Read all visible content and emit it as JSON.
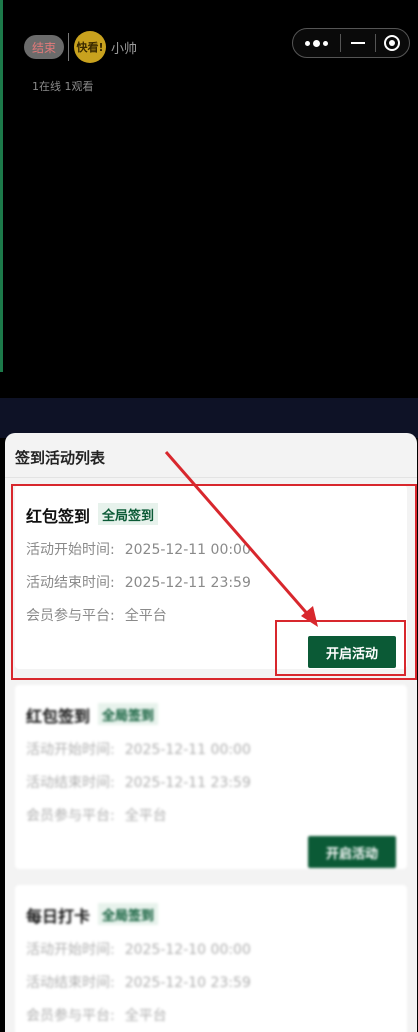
{
  "top_bar": {
    "end_label": "结束",
    "avatar_text": "快看!",
    "anchor_name": "小帅",
    "online_stats": "1在线 1观看"
  },
  "sheet": {
    "title": "签到活动列表"
  },
  "activities": [
    {
      "title": "红包签到",
      "badge": "全局签到",
      "start_label": "活动开始时间:",
      "start_value": "2025-12-11 00:00",
      "end_label": "活动结束时间:",
      "end_value": "2025-12-11 23:59",
      "platform_label": "会员参与平台:",
      "platform_value": "全平台",
      "button": "开启活动"
    },
    {
      "title": "红包签到",
      "badge": "全局签到",
      "start_label": "活动开始时间:",
      "start_value": "2025-12-11 00:00",
      "end_label": "活动结束时间:",
      "end_value": "2025-12-11 23:59",
      "platform_label": "会员参与平台:",
      "platform_value": "全平台",
      "button": "开启活动"
    },
    {
      "title": "每日打卡",
      "badge": "全局签到",
      "start_label": "活动开始时间:",
      "start_value": "2025-12-10 00:00",
      "end_label": "活动结束时间:",
      "end_value": "2025-12-10 23:59",
      "platform_label": "会员参与平台:",
      "platform_value": "全平台"
    }
  ],
  "colors": {
    "primary_green": "#0b5a36",
    "badge_bg": "#e7f2ec",
    "highlight_red": "#d8272d"
  },
  "icons": [
    "more-dots-icon",
    "minimize-icon",
    "close-target-icon"
  ]
}
